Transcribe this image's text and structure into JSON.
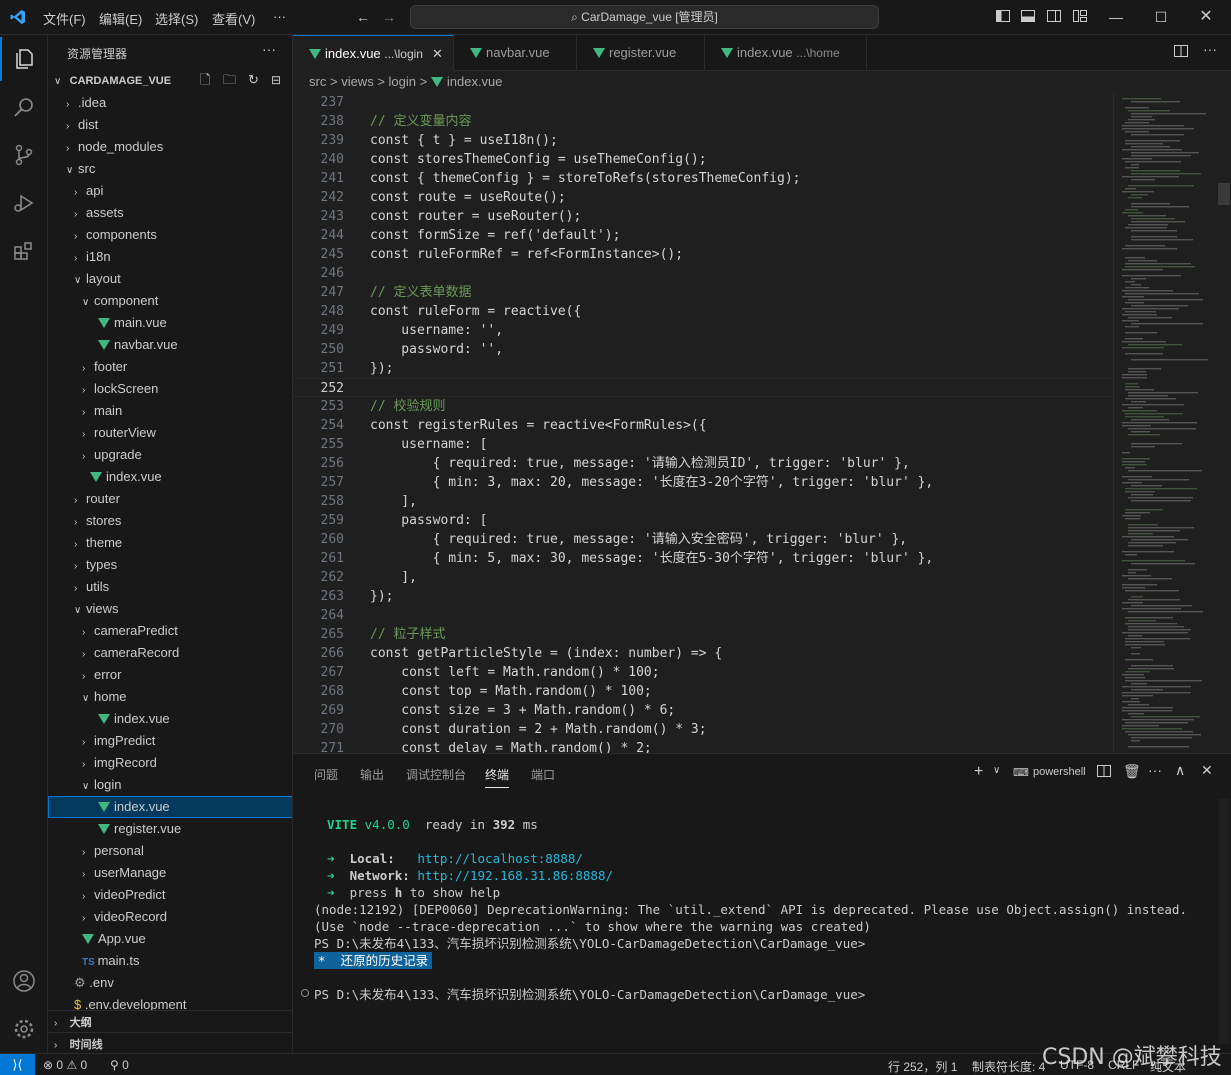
{
  "menu": [
    "文件(F)",
    "编辑(E)",
    "选择(S)",
    "查看(V)",
    "···"
  ],
  "search": "CarDamage_vue [管理员]",
  "sidebar": {
    "title": "资源管理器",
    "project": "CARDAMAGE_VUE",
    "tree": [
      {
        "label": ".idea",
        "indent": 0,
        "kind": "folder",
        "open": false
      },
      {
        "label": "dist",
        "indent": 0,
        "kind": "folder",
        "open": false
      },
      {
        "label": "node_modules",
        "indent": 0,
        "kind": "folder",
        "open": false
      },
      {
        "label": "src",
        "indent": 0,
        "kind": "folder",
        "open": true
      },
      {
        "label": "api",
        "indent": 1,
        "kind": "folder",
        "open": false
      },
      {
        "label": "assets",
        "indent": 1,
        "kind": "folder",
        "open": false
      },
      {
        "label": "components",
        "indent": 1,
        "kind": "folder",
        "open": false
      },
      {
        "label": "i18n",
        "indent": 1,
        "kind": "folder",
        "open": false
      },
      {
        "label": "layout",
        "indent": 1,
        "kind": "folder",
        "open": true
      },
      {
        "label": "component",
        "indent": 2,
        "kind": "folder",
        "open": true
      },
      {
        "label": "main.vue",
        "indent": 3,
        "kind": "vue"
      },
      {
        "label": "navbar.vue",
        "indent": 3,
        "kind": "vue"
      },
      {
        "label": "footer",
        "indent": 2,
        "kind": "folder",
        "open": false
      },
      {
        "label": "lockScreen",
        "indent": 2,
        "kind": "folder",
        "open": false
      },
      {
        "label": "main",
        "indent": 2,
        "kind": "folder",
        "open": false
      },
      {
        "label": "routerView",
        "indent": 2,
        "kind": "folder",
        "open": false
      },
      {
        "label": "upgrade",
        "indent": 2,
        "kind": "folder",
        "open": false
      },
      {
        "label": "index.vue",
        "indent": 2,
        "kind": "vue"
      },
      {
        "label": "router",
        "indent": 1,
        "kind": "folder",
        "open": false
      },
      {
        "label": "stores",
        "indent": 1,
        "kind": "folder",
        "open": false
      },
      {
        "label": "theme",
        "indent": 1,
        "kind": "folder",
        "open": false
      },
      {
        "label": "types",
        "indent": 1,
        "kind": "folder",
        "open": false
      },
      {
        "label": "utils",
        "indent": 1,
        "kind": "folder",
        "open": false
      },
      {
        "label": "views",
        "indent": 1,
        "kind": "folder",
        "open": true
      },
      {
        "label": "cameraPredict",
        "indent": 2,
        "kind": "folder",
        "open": false
      },
      {
        "label": "cameraRecord",
        "indent": 2,
        "kind": "folder",
        "open": false
      },
      {
        "label": "error",
        "indent": 2,
        "kind": "folder",
        "open": false
      },
      {
        "label": "home",
        "indent": 2,
        "kind": "folder",
        "open": true
      },
      {
        "label": "index.vue",
        "indent": 3,
        "kind": "vue"
      },
      {
        "label": "imgPredict",
        "indent": 2,
        "kind": "folder",
        "open": false
      },
      {
        "label": "imgRecord",
        "indent": 2,
        "kind": "folder",
        "open": false
      },
      {
        "label": "login",
        "indent": 2,
        "kind": "folder",
        "open": true
      },
      {
        "label": "index.vue",
        "indent": 3,
        "kind": "vue",
        "selected": true
      },
      {
        "label": "register.vue",
        "indent": 3,
        "kind": "vue"
      },
      {
        "label": "personal",
        "indent": 2,
        "kind": "folder",
        "open": false
      },
      {
        "label": "userManage",
        "indent": 2,
        "kind": "folder",
        "open": false
      },
      {
        "label": "videoPredict",
        "indent": 2,
        "kind": "folder",
        "open": false
      },
      {
        "label": "videoRecord",
        "indent": 2,
        "kind": "folder",
        "open": false
      },
      {
        "label": "App.vue",
        "indent": 1,
        "kind": "vue"
      },
      {
        "label": "main.ts",
        "indent": 1,
        "kind": "ts"
      },
      {
        "label": ".env",
        "indent": 0,
        "kind": "gear"
      },
      {
        "label": ".env.development",
        "indent": 0,
        "kind": "dollar"
      }
    ],
    "outline": "大纲",
    "timeline": "时间线"
  },
  "tabs": [
    {
      "name": "index.vue",
      "hint": "...\\login",
      "active": true
    },
    {
      "name": "navbar.vue",
      "hint": ""
    },
    {
      "name": "register.vue",
      "hint": ""
    },
    {
      "name": "index.vue",
      "hint": "...\\home"
    }
  ],
  "breadcrumb": [
    "src",
    ">",
    "views",
    ">",
    "login",
    ">",
    "index.vue"
  ],
  "code": [
    {
      "n": "237",
      "t": ""
    },
    {
      "n": "238",
      "t": "// 定义变量内容"
    },
    {
      "n": "239",
      "t": "const { t } = useI18n();"
    },
    {
      "n": "240",
      "t": "const storesThemeConfig = useThemeConfig();"
    },
    {
      "n": "241",
      "t": "const { themeConfig } = storeToRefs(storesThemeConfig);"
    },
    {
      "n": "242",
      "t": "const route = useRoute();"
    },
    {
      "n": "243",
      "t": "const router = useRouter();"
    },
    {
      "n": "244",
      "t": "const formSize = ref('default');"
    },
    {
      "n": "245",
      "t": "const ruleFormRef = ref<FormInstance>();"
    },
    {
      "n": "246",
      "t": ""
    },
    {
      "n": "247",
      "t": "// 定义表单数据"
    },
    {
      "n": "248",
      "t": "const ruleForm = reactive({"
    },
    {
      "n": "249",
      "t": "    username: '',"
    },
    {
      "n": "250",
      "t": "    password: '',"
    },
    {
      "n": "251",
      "t": "});"
    },
    {
      "n": "252",
      "t": "",
      "current": true
    },
    {
      "n": "253",
      "t": "// 校验规则"
    },
    {
      "n": "254",
      "t": "const registerRules = reactive<FormRules>({"
    },
    {
      "n": "255",
      "t": "    username: ["
    },
    {
      "n": "256",
      "t": "        { required: true, message: '请输入检测员ID', trigger: 'blur' },"
    },
    {
      "n": "257",
      "t": "        { min: 3, max: 20, message: '长度在3-20个字符', trigger: 'blur' },"
    },
    {
      "n": "258",
      "t": "    ],"
    },
    {
      "n": "259",
      "t": "    password: ["
    },
    {
      "n": "260",
      "t": "        { required: true, message: '请输入安全密码', trigger: 'blur' },"
    },
    {
      "n": "261",
      "t": "        { min: 5, max: 30, message: '长度在5-30个字符', trigger: 'blur' },"
    },
    {
      "n": "262",
      "t": "    ],"
    },
    {
      "n": "263",
      "t": "});"
    },
    {
      "n": "264",
      "t": ""
    },
    {
      "n": "265",
      "t": "// 粒子样式"
    },
    {
      "n": "266",
      "t": "const getParticleStyle = (index: number) => {"
    },
    {
      "n": "267",
      "t": "    const left = Math.random() * 100;"
    },
    {
      "n": "268",
      "t": "    const top = Math.random() * 100;"
    },
    {
      "n": "269",
      "t": "    const size = 3 + Math.random() * 6;"
    },
    {
      "n": "270",
      "t": "    const duration = 2 + Math.random() * 3;"
    },
    {
      "n": "271",
      "t": "    const delay = Math.random() * 2;"
    }
  ],
  "panel": {
    "tabs": [
      "问题",
      "输出",
      "调试控制台",
      "终端",
      "端口"
    ],
    "active": 3,
    "shell": "powershell"
  },
  "terminal": {
    "vite": "VITE",
    "version": "v4.0.0",
    "ready1": "ready in",
    "ms_val": "392",
    "ready2": "ms",
    "local_label": "Local:",
    "local_url": "http://localhost:8888/",
    "network_label": "Network:",
    "network_url": "http://192.168.31.86:8888/",
    "press": "press",
    "h": "h",
    "help": "to show help",
    "warn1": "(node:12192) [DEP0060] DeprecationWarning: The `util._extend` API is deprecated. Please use Object.assign() instead.",
    "warn2": "(Use `node --trace-deprecation ...` to show where the warning was created)",
    "ps1": "PS D:\\未发布4\\133、汽车损坏识别检测系统\\YOLO-CarDamageDetection\\CarDamage_vue>",
    "restored": "还原的历史记录",
    "ps2": "PS D:\\未发布4\\133、汽车损坏识别检测系统\\YOLO-CarDamageDetection\\CarDamage_vue>"
  },
  "status": {
    "errors": "0",
    "warnings": "0",
    "ports": "0",
    "position": "行 252，列 1",
    "tab": "制表符长度: 4",
    "enc": "UTF-8",
    "eol": "CRLF",
    "lang": "纯文本"
  },
  "watermark": "CSDN @斌攀科技"
}
